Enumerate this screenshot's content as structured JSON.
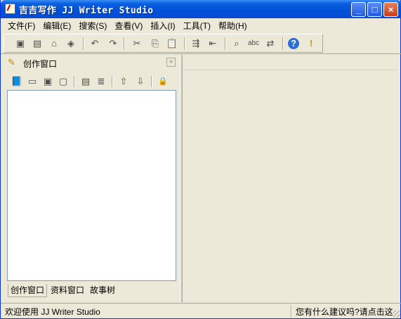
{
  "window": {
    "title": "吉吉写作 JJ Writer Studio",
    "controls": {
      "minimize": "_",
      "maximize": "□",
      "close": "×"
    }
  },
  "menu": [
    {
      "label": "文件(F)"
    },
    {
      "label": "编辑(E)"
    },
    {
      "label": "搜索(S)"
    },
    {
      "label": "查看(V)"
    },
    {
      "label": "插入(I)"
    },
    {
      "label": "工具(T)"
    },
    {
      "label": "帮助(H)"
    }
  ],
  "toolbar": {
    "icons": [
      "save-icon",
      "save-all-icon",
      "open-icon",
      "recent-icon",
      "undo-icon",
      "redo-icon",
      "cut-icon",
      "copy-icon",
      "paste-icon",
      "indent-icon",
      "outdent-icon",
      "find-icon",
      "spell-icon",
      "replace-icon",
      "help-icon",
      "tip-icon"
    ],
    "glyphs": {
      "save": "▣",
      "save_all": "▤",
      "open": "⌂",
      "recent": "◈",
      "undo": "↶",
      "redo": "↷",
      "cut": "✂",
      "copy": "⎘",
      "paste": "📋",
      "indent": "⇶",
      "outdent": "⇤",
      "find": "⌕",
      "spell": "abc",
      "replace": "⇄",
      "help": "?",
      "tip": "!"
    }
  },
  "left_pane": {
    "title": "创作窗口",
    "close_glyph": "×",
    "toolbar_glyphs": {
      "book": "📘",
      "new": "▭",
      "add": "▣",
      "delete": "▢",
      "props": "▤",
      "list": "≣",
      "up": "⇧",
      "down": "⇩",
      "lock": "🔒"
    },
    "tabs": [
      {
        "label": "创作窗口"
      },
      {
        "label": "资料窗口"
      },
      {
        "label": "故事树"
      }
    ]
  },
  "status": {
    "left": "欢迎使用 JJ Writer Studio",
    "right": "您有什么建议吗?请点击这"
  },
  "colors": {
    "title_bar": "#0a5fe0",
    "face": "#ece9d8",
    "close_button": "#c83c18"
  }
}
